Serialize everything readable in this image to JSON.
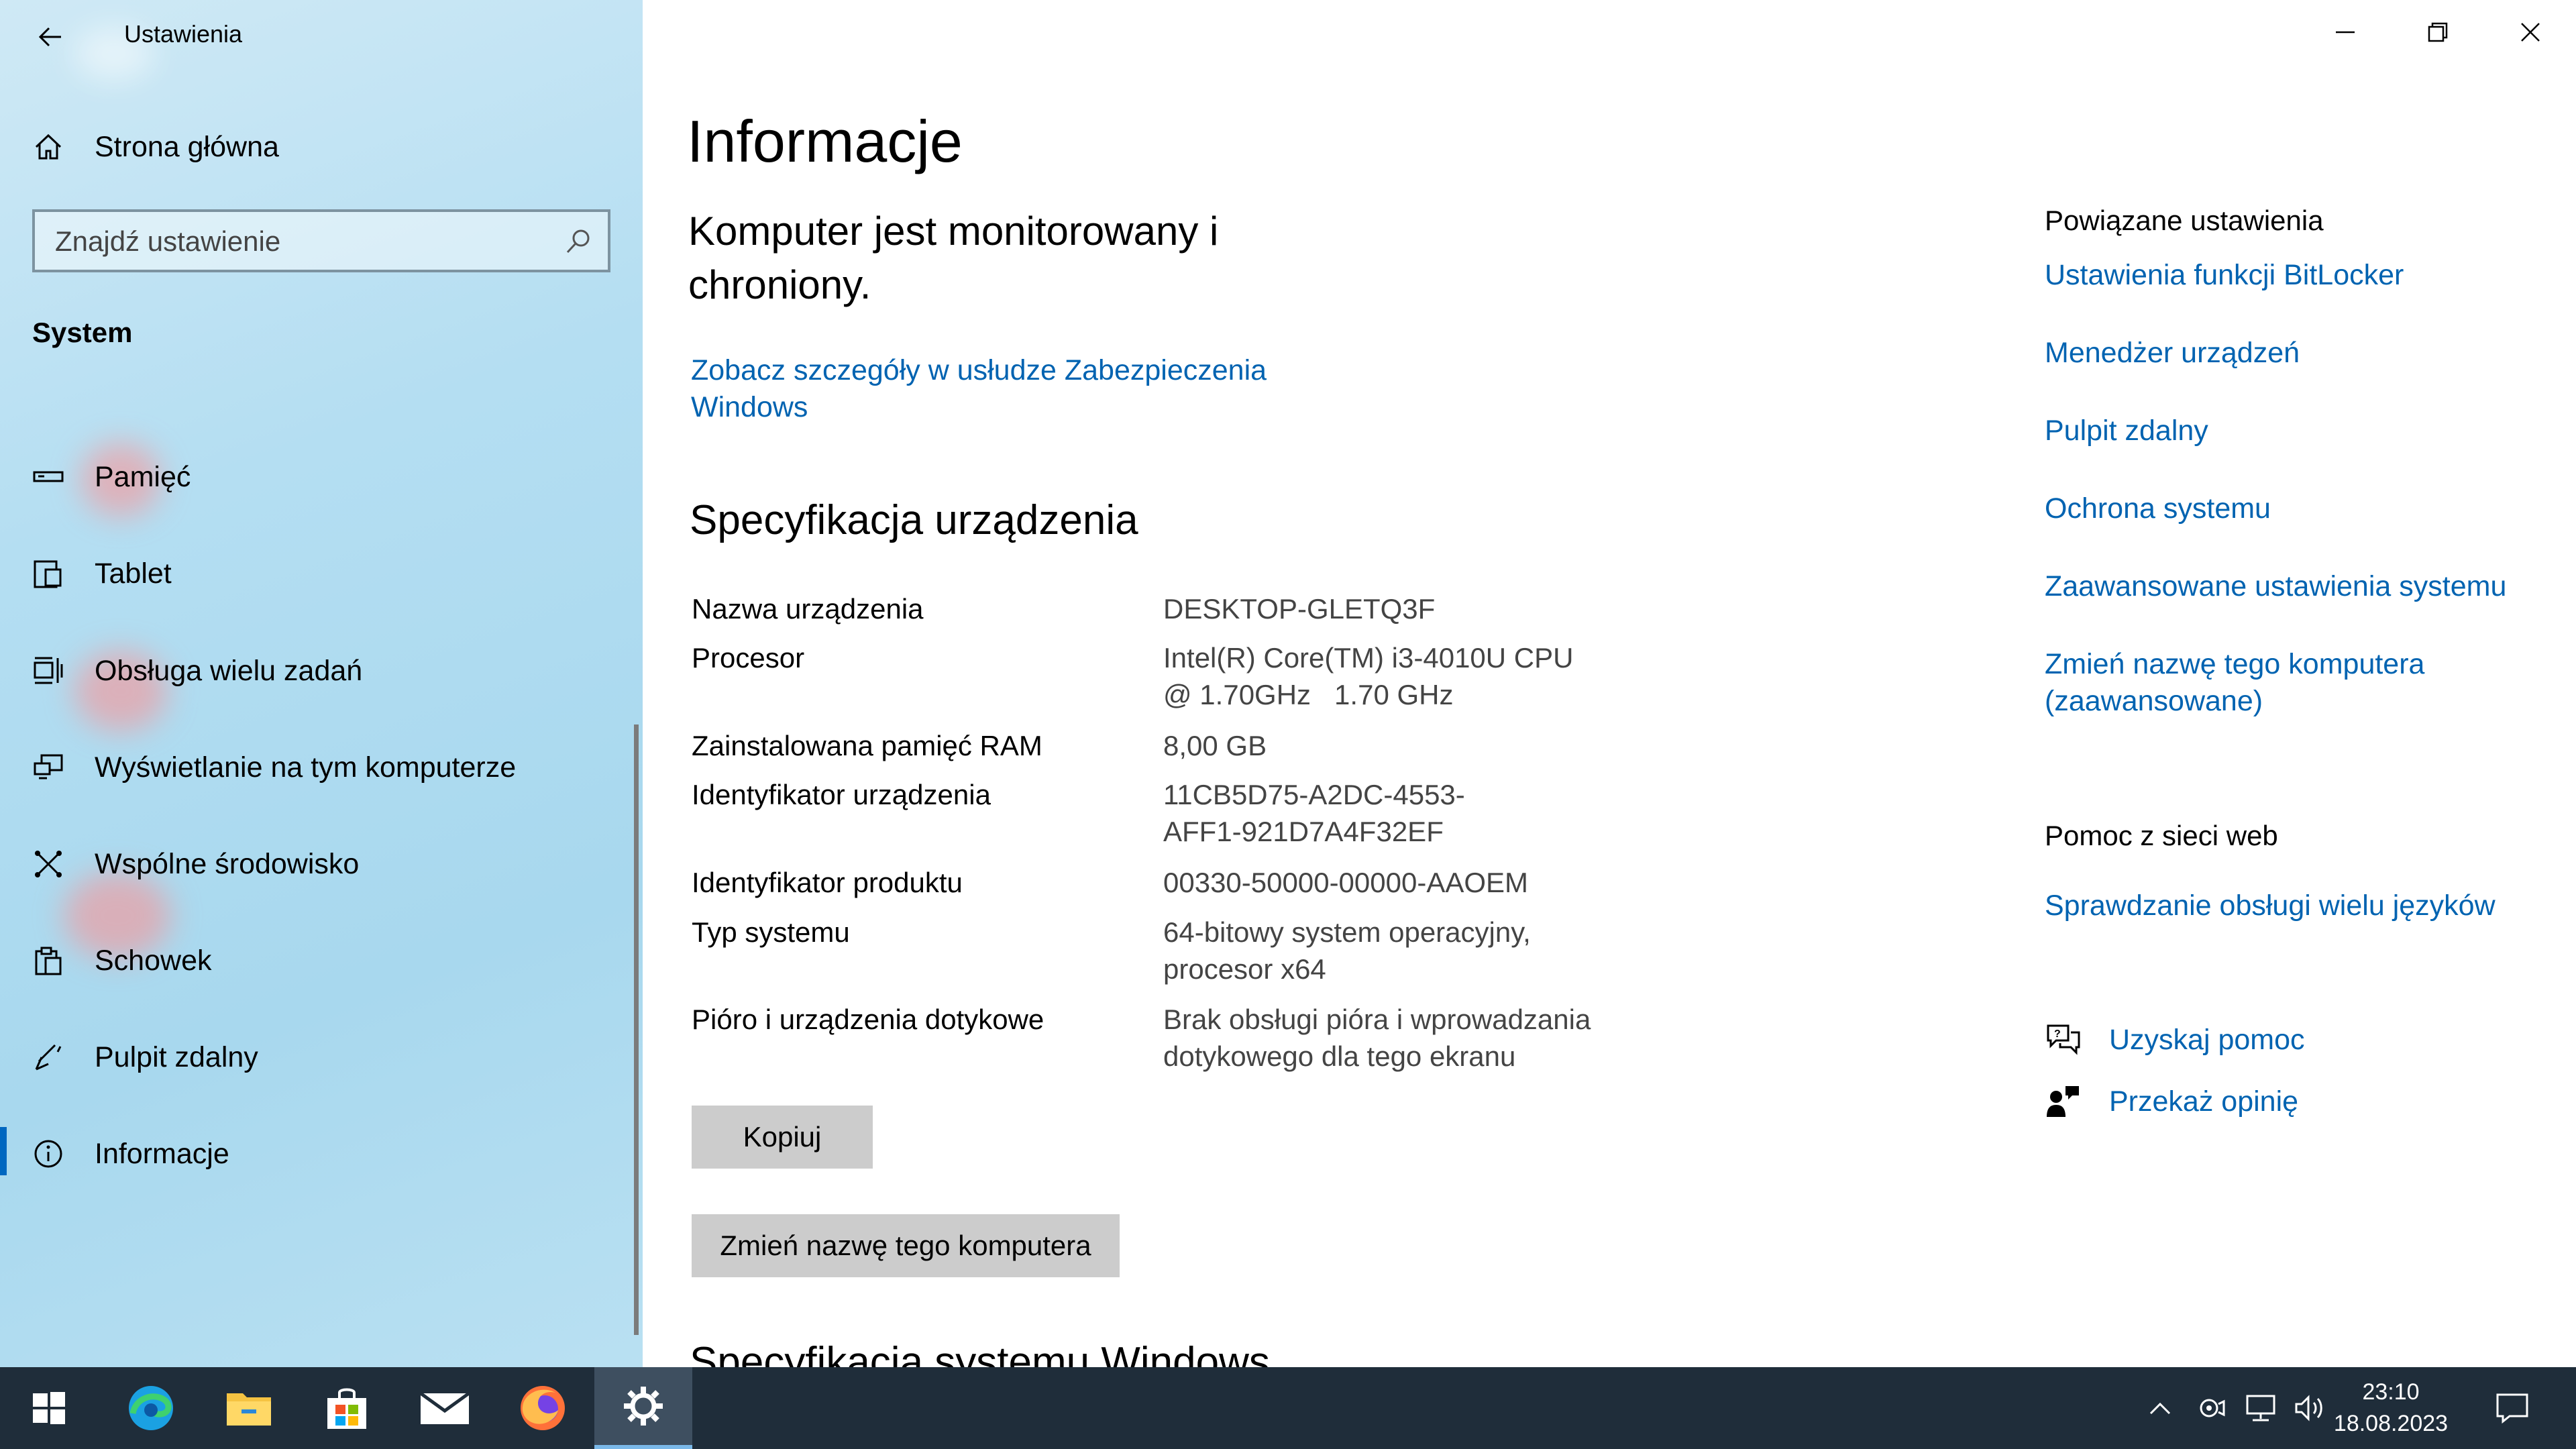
{
  "window": {
    "title": "Ustawienia"
  },
  "sidebar": {
    "home_label": "Strona główna",
    "search_placeholder": "Znajdź ustawienie",
    "section_label": "System",
    "items": [
      {
        "label": "Pamięć",
        "icon": "storage-icon"
      },
      {
        "label": "Tablet",
        "icon": "tablet-icon"
      },
      {
        "label": "Obsługa wielu zadań",
        "icon": "multitasking-icon"
      },
      {
        "label": "Wyświetlanie na tym komputerze",
        "icon": "projecting-icon"
      },
      {
        "label": "Wspólne środowisko",
        "icon": "shared-experiences-icon"
      },
      {
        "label": "Schowek",
        "icon": "clipboard-icon"
      },
      {
        "label": "Pulpit zdalny",
        "icon": "remote-desktop-icon"
      },
      {
        "label": "Informacje",
        "icon": "info-icon",
        "selected": true
      }
    ]
  },
  "main": {
    "title": "Informacje",
    "status_text": "Komputer jest monitorowany i chroniony.",
    "security_link": "Zobacz szczegóły w usłudze Zabezpieczenia Windows",
    "spec_title": "Specyfikacja urządzenia",
    "specs": [
      {
        "label": "Nazwa urządzenia",
        "value": "DESKTOP-GLETQ3F"
      },
      {
        "label": "Procesor",
        "value": "Intel(R) Core(TM) i3-4010U CPU @ 1.70GHz   1.70 GHz"
      },
      {
        "label": "Zainstalowana pamięć RAM",
        "value": "8,00 GB"
      },
      {
        "label": "Identyfikator urządzenia",
        "value": "11CB5D75-A2DC-4553-AFF1-921D7A4F32EF"
      },
      {
        "label": "Identyfikator produktu",
        "value": "00330-50000-00000-AAOEM"
      },
      {
        "label": "Typ systemu",
        "value": "64-bitowy system operacyjny, procesor x64"
      },
      {
        "label": "Pióro i urządzenia dotykowe",
        "value": "Brak obsługi pióra i wprowadzania dotykowego dla tego ekranu"
      }
    ],
    "copy_button": "Kopiuj",
    "rename_button": "Zmień nazwę tego komputera",
    "windows_spec_title": "Specyfikacja systemu Windows"
  },
  "related": {
    "title": "Powiązane ustawienia",
    "links": [
      "Ustawienia funkcji BitLocker",
      "Menedżer urządzeń",
      "Pulpit zdalny",
      "Ochrona systemu",
      "Zaawansowane ustawienia systemu",
      "Zmień nazwę tego komputera (zaawansowane)"
    ],
    "web_help_title": "Pomoc z sieci web",
    "web_help_link": "Sprawdzanie obsługi wielu języków",
    "get_help": "Uzyskaj pomoc",
    "feedback": "Przekaż opinię"
  },
  "taskbar": {
    "apps": [
      "start-icon",
      "edge-icon",
      "file-explorer-icon",
      "store-icon",
      "mail-icon",
      "firefox-icon",
      "settings-icon"
    ],
    "active_app": "settings-icon",
    "time": "23:10",
    "date": "18.08.2023"
  },
  "colors": {
    "accent": "#0067c0",
    "link": "#0063b1",
    "taskbar": "#1f2d3a",
    "sidebar": "#b4def2"
  }
}
